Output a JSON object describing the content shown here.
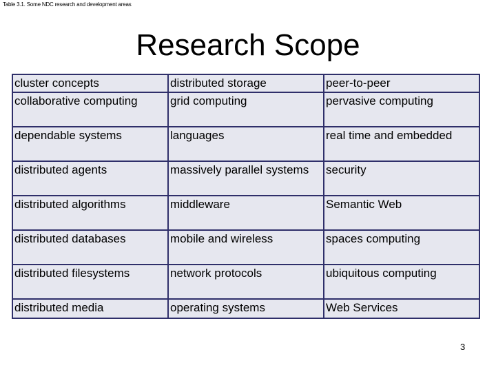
{
  "caption": "Table 3.1. Some NDC research and development areas",
  "title": "Research Scope",
  "table": {
    "rows": [
      [
        "cluster concepts",
        "distributed storage",
        "peer-to-peer"
      ],
      [
        "collaborative computing",
        "grid computing",
        "pervasive computing"
      ],
      [
        "dependable systems",
        "languages",
        "real time and embedded"
      ],
      [
        "distributed agents",
        "massively parallel systems",
        "security"
      ],
      [
        "distributed algorithms",
        "middleware",
        "Semantic Web"
      ],
      [
        "distributed databases",
        "mobile and wireless",
        "spaces computing"
      ],
      [
        "distributed filesystems",
        "network protocols",
        "ubiquitous computing"
      ],
      [
        "distributed media",
        "operating systems",
        "Web Services"
      ]
    ]
  },
  "page_number": "3"
}
